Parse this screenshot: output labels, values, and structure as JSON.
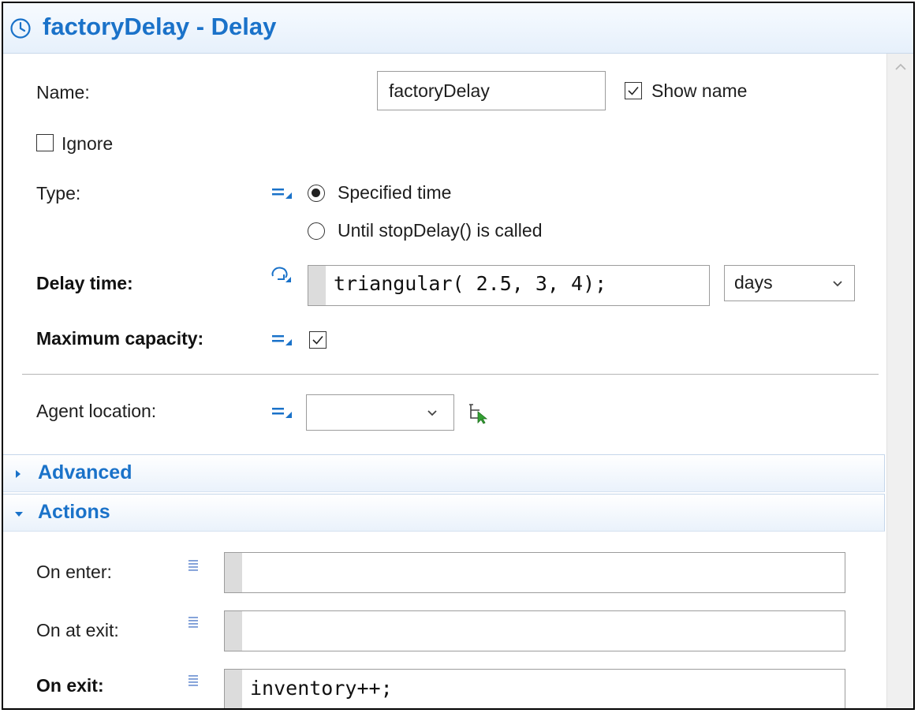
{
  "header": {
    "title": "factoryDelay - Delay",
    "icon": "clock-icon",
    "accent_color": "#1a72c9"
  },
  "form": {
    "name_label": "Name:",
    "name_value": "factoryDelay",
    "show_name_label": "Show name",
    "show_name_checked": true,
    "ignore_label": "Ignore",
    "ignore_checked": false,
    "type_label": "Type:",
    "type_options": [
      {
        "label": "Specified time",
        "selected": true
      },
      {
        "label": "Until stopDelay() is called",
        "selected": false
      }
    ],
    "delay_time_label": "Delay time:",
    "delay_time_value": "triangular( 2.5, 3, 4);",
    "delay_time_unit": "days",
    "max_capacity_label": "Maximum capacity:",
    "max_capacity_checked": true,
    "agent_location_label": "Agent location:",
    "agent_location_value": ""
  },
  "sections": {
    "advanced": {
      "title": "Advanced",
      "expanded": false
    },
    "actions": {
      "title": "Actions",
      "expanded": true
    }
  },
  "actions": {
    "on_enter_label": "On enter:",
    "on_enter_value": "",
    "on_at_exit_label": "On at exit:",
    "on_at_exit_value": "",
    "on_exit_label": "On exit:",
    "on_exit_value": "inventory++;"
  }
}
